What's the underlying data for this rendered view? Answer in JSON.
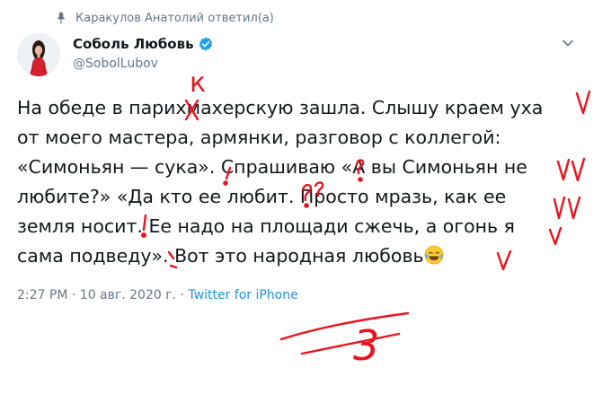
{
  "retweet": {
    "text": "Каракулов Анатолий ответил(а)",
    "icon": "pin-icon"
  },
  "author": {
    "name": "Соболь Любовь",
    "handle": "@SobolLubov",
    "verified": true,
    "verified_color": "#1da1f2"
  },
  "tweet": {
    "lines": [
      "На обеде в парихмахерскую зашла. Слышу краем уха",
      "от моего мастера, армянки, разговор с коллегой:",
      "«Симоньян — сука». Спрашиваю «А вы Симоньян не",
      "любите?» «Да кто ее любит. Просто мразь, как ее",
      "земля носит. Ее надо на площади сжечь, а огонь я",
      "сама подведу». Вот это народная любовь"
    ],
    "emoji": "face-with-tears-of-joy-icon"
  },
  "meta": {
    "time": "2:27 PM",
    "sep1": " · ",
    "date": "10 авг. 2020 г.",
    "sep2": " · ",
    "source": "Twitter for iPhone"
  },
  "annotations": {
    "correction_letter": "к",
    "grade": "3",
    "ink_color": "#e8141e"
  },
  "colors": {
    "text": "#14171a",
    "secondary": "#657786",
    "link": "#1b95e0"
  }
}
